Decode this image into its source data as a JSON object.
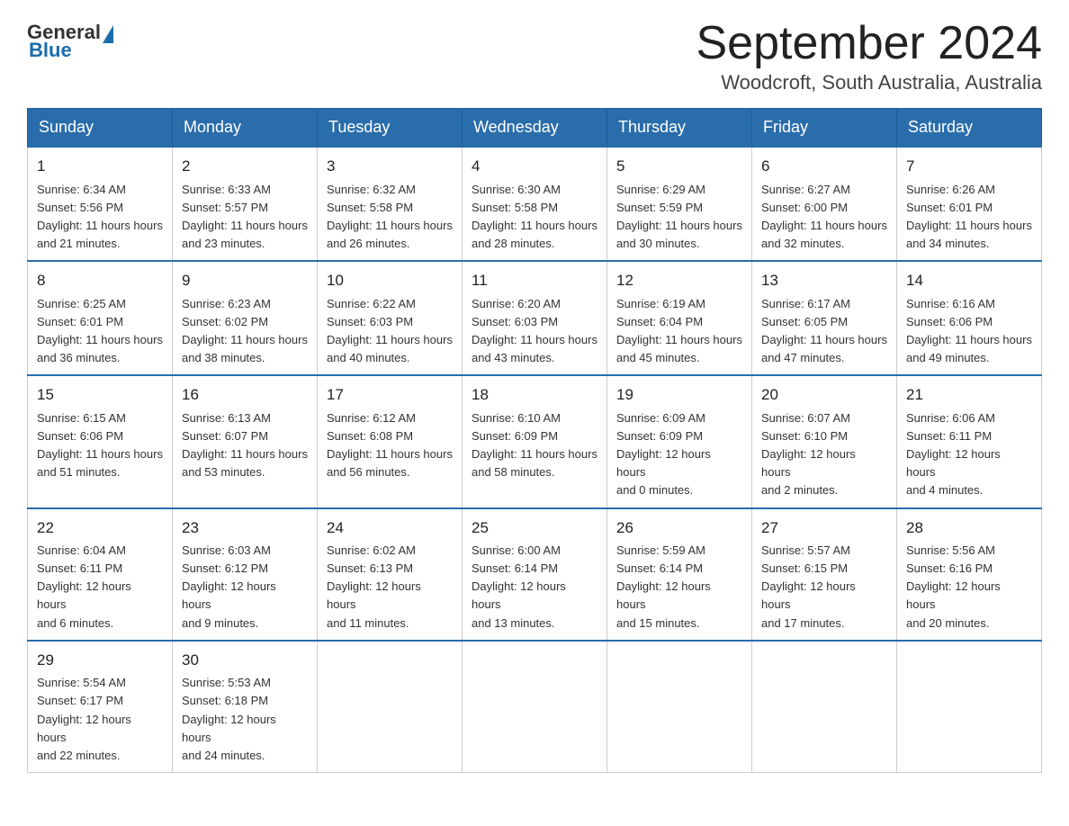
{
  "logo": {
    "general": "General",
    "blue": "Blue"
  },
  "title": "September 2024",
  "location": "Woodcroft, South Australia, Australia",
  "days_of_week": [
    "Sunday",
    "Monday",
    "Tuesday",
    "Wednesday",
    "Thursday",
    "Friday",
    "Saturday"
  ],
  "weeks": [
    [
      {
        "day": "1",
        "sunrise": "6:34 AM",
        "sunset": "5:56 PM",
        "daylight": "11 hours and 21 minutes."
      },
      {
        "day": "2",
        "sunrise": "6:33 AM",
        "sunset": "5:57 PM",
        "daylight": "11 hours and 23 minutes."
      },
      {
        "day": "3",
        "sunrise": "6:32 AM",
        "sunset": "5:58 PM",
        "daylight": "11 hours and 26 minutes."
      },
      {
        "day": "4",
        "sunrise": "6:30 AM",
        "sunset": "5:58 PM",
        "daylight": "11 hours and 28 minutes."
      },
      {
        "day": "5",
        "sunrise": "6:29 AM",
        "sunset": "5:59 PM",
        "daylight": "11 hours and 30 minutes."
      },
      {
        "day": "6",
        "sunrise": "6:27 AM",
        "sunset": "6:00 PM",
        "daylight": "11 hours and 32 minutes."
      },
      {
        "day": "7",
        "sunrise": "6:26 AM",
        "sunset": "6:01 PM",
        "daylight": "11 hours and 34 minutes."
      }
    ],
    [
      {
        "day": "8",
        "sunrise": "6:25 AM",
        "sunset": "6:01 PM",
        "daylight": "11 hours and 36 minutes."
      },
      {
        "day": "9",
        "sunrise": "6:23 AM",
        "sunset": "6:02 PM",
        "daylight": "11 hours and 38 minutes."
      },
      {
        "day": "10",
        "sunrise": "6:22 AM",
        "sunset": "6:03 PM",
        "daylight": "11 hours and 40 minutes."
      },
      {
        "day": "11",
        "sunrise": "6:20 AM",
        "sunset": "6:03 PM",
        "daylight": "11 hours and 43 minutes."
      },
      {
        "day": "12",
        "sunrise": "6:19 AM",
        "sunset": "6:04 PM",
        "daylight": "11 hours and 45 minutes."
      },
      {
        "day": "13",
        "sunrise": "6:17 AM",
        "sunset": "6:05 PM",
        "daylight": "11 hours and 47 minutes."
      },
      {
        "day": "14",
        "sunrise": "6:16 AM",
        "sunset": "6:06 PM",
        "daylight": "11 hours and 49 minutes."
      }
    ],
    [
      {
        "day": "15",
        "sunrise": "6:15 AM",
        "sunset": "6:06 PM",
        "daylight": "11 hours and 51 minutes."
      },
      {
        "day": "16",
        "sunrise": "6:13 AM",
        "sunset": "6:07 PM",
        "daylight": "11 hours and 53 minutes."
      },
      {
        "day": "17",
        "sunrise": "6:12 AM",
        "sunset": "6:08 PM",
        "daylight": "11 hours and 56 minutes."
      },
      {
        "day": "18",
        "sunrise": "6:10 AM",
        "sunset": "6:09 PM",
        "daylight": "11 hours and 58 minutes."
      },
      {
        "day": "19",
        "sunrise": "6:09 AM",
        "sunset": "6:09 PM",
        "daylight": "12 hours and 0 minutes."
      },
      {
        "day": "20",
        "sunrise": "6:07 AM",
        "sunset": "6:10 PM",
        "daylight": "12 hours and 2 minutes."
      },
      {
        "day": "21",
        "sunrise": "6:06 AM",
        "sunset": "6:11 PM",
        "daylight": "12 hours and 4 minutes."
      }
    ],
    [
      {
        "day": "22",
        "sunrise": "6:04 AM",
        "sunset": "6:11 PM",
        "daylight": "12 hours and 6 minutes."
      },
      {
        "day": "23",
        "sunrise": "6:03 AM",
        "sunset": "6:12 PM",
        "daylight": "12 hours and 9 minutes."
      },
      {
        "day": "24",
        "sunrise": "6:02 AM",
        "sunset": "6:13 PM",
        "daylight": "12 hours and 11 minutes."
      },
      {
        "day": "25",
        "sunrise": "6:00 AM",
        "sunset": "6:14 PM",
        "daylight": "12 hours and 13 minutes."
      },
      {
        "day": "26",
        "sunrise": "5:59 AM",
        "sunset": "6:14 PM",
        "daylight": "12 hours and 15 minutes."
      },
      {
        "day": "27",
        "sunrise": "5:57 AM",
        "sunset": "6:15 PM",
        "daylight": "12 hours and 17 minutes."
      },
      {
        "day": "28",
        "sunrise": "5:56 AM",
        "sunset": "6:16 PM",
        "daylight": "12 hours and 20 minutes."
      }
    ],
    [
      {
        "day": "29",
        "sunrise": "5:54 AM",
        "sunset": "6:17 PM",
        "daylight": "12 hours and 22 minutes."
      },
      {
        "day": "30",
        "sunrise": "5:53 AM",
        "sunset": "6:18 PM",
        "daylight": "12 hours and 24 minutes."
      },
      null,
      null,
      null,
      null,
      null
    ]
  ],
  "labels": {
    "sunrise": "Sunrise: ",
    "sunset": "Sunset: ",
    "daylight": "Daylight: "
  }
}
